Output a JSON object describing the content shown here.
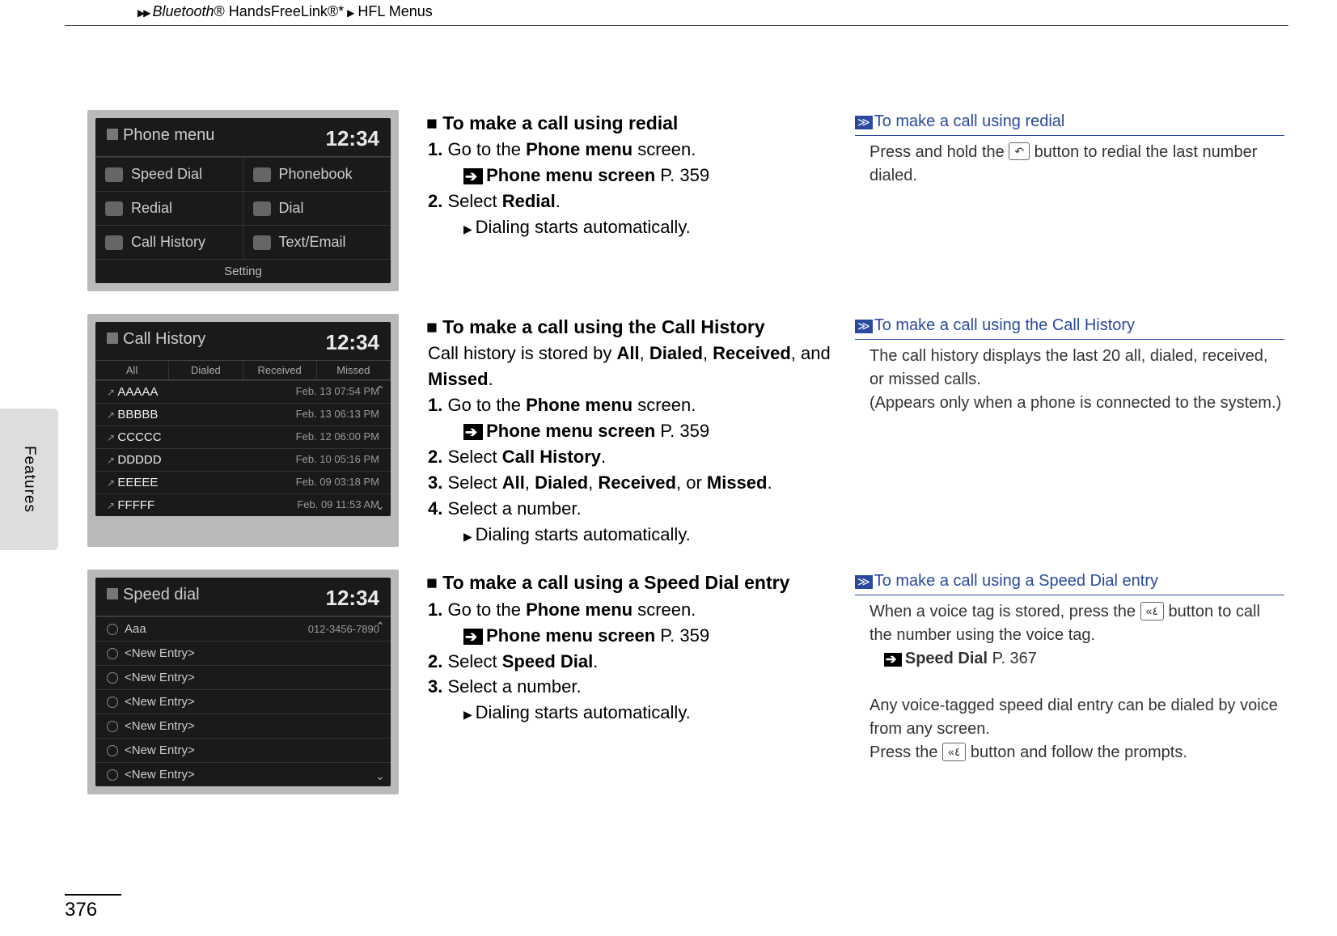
{
  "breadcrumb": {
    "section1": "Bluetooth",
    "reg1": "®",
    "section2": " HandsFreeLink",
    "reg2": "®*",
    "section3": "HFL Menus"
  },
  "sidetab": "Features",
  "page_number": "376",
  "clock": "12:34",
  "screens": {
    "phone_menu": {
      "title": "Phone menu",
      "items": [
        "Speed Dial",
        "Phonebook",
        "Redial",
        "Dial",
        "Call History",
        "Text/Email"
      ],
      "footer": "Setting"
    },
    "call_history": {
      "title": "Call History",
      "tabs": [
        "All",
        "Dialed",
        "Received",
        "Missed"
      ],
      "rows": [
        {
          "n": "AAAAA",
          "d": "Feb. 13 07:54 PM"
        },
        {
          "n": "BBBBB",
          "d": "Feb. 13 06:13 PM"
        },
        {
          "n": "CCCCC",
          "d": "Feb. 12 06:00 PM"
        },
        {
          "n": "DDDDD",
          "d": "Feb. 10 05:16 PM"
        },
        {
          "n": "EEEEE",
          "d": "Feb. 09 03:18 PM"
        },
        {
          "n": "FFFFF",
          "d": "Feb. 09 11:53 AM"
        }
      ]
    },
    "speed_dial": {
      "title": "Speed dial",
      "first": {
        "name": "Aaa",
        "num": "012-3456-7890"
      },
      "empty": "<New Entry>"
    }
  },
  "blocks": {
    "redial": {
      "title": "To make a call using redial",
      "s1a": "1. ",
      "s1b": "Go to the ",
      "s1c": "Phone menu",
      "s1d": " screen.",
      "xref": "Phone menu screen",
      "xpg": " P. 359",
      "s2a": "2. ",
      "s2b": "Select ",
      "s2c": "Redial",
      "s2d": ".",
      "res": "Dialing starts automatically.",
      "side_title": "To make a call using redial",
      "side1": "Press and hold the ",
      "side_key": "↶",
      "side2": " button to redial the last number dialed."
    },
    "history": {
      "title": "To make a call using the Call History",
      "intro1": "Call history is stored by ",
      "b1": "All",
      "c1": ", ",
      "b2": "Dialed",
      "c2": ", ",
      "b3": "Received",
      "c3": ", and ",
      "b4": "Missed",
      "c4": ".",
      "s1a": "1. ",
      "s1b": "Go to the ",
      "s1c": "Phone menu",
      "s1d": " screen.",
      "xref": "Phone menu screen",
      "xpg": " P. 359",
      "s2a": "2. ",
      "s2b": "Select ",
      "s2c": "Call History",
      "s2d": ".",
      "s3a": "3. ",
      "s3b": "Select ",
      "s3c": "All",
      "s3d": ", ",
      "s3e": "Dialed",
      "s3f": ", ",
      "s3g": "Received",
      "s3h": ", or ",
      "s3i": "Missed",
      "s3j": ".",
      "s4a": "4. ",
      "s4b": "Select a number.",
      "res": "Dialing starts automatically.",
      "side_title": "To make a call using the Call History",
      "side1": "The call history displays the last 20 all, dialed, received, or missed calls.",
      "side2": "(Appears only when a phone is connected to the system.)"
    },
    "speed": {
      "title": "To make a call using a Speed Dial entry",
      "s1a": "1. ",
      "s1b": "Go to the ",
      "s1c": "Phone menu",
      "s1d": " screen.",
      "xref": "Phone menu screen",
      "xpg": " P. 359",
      "s2a": "2. ",
      "s2b": "Select ",
      "s2c": "Speed Dial",
      "s2d": ".",
      "s3a": "3. ",
      "s3b": "Select a number.",
      "res": "Dialing starts automatically.",
      "side_title": "To make a call using a Speed Dial entry",
      "side1": "When a voice tag is stored, press the ",
      "side_key": "«٤",
      "side2": " button to call the number using the voice tag.",
      "side_xref": "Speed Dial",
      "side_xpg": " P. 367",
      "side3": "Any voice-tagged speed dial entry can be dialed by voice from any screen.",
      "side4a": "Press the ",
      "side4b": " button and follow the prompts."
    }
  }
}
